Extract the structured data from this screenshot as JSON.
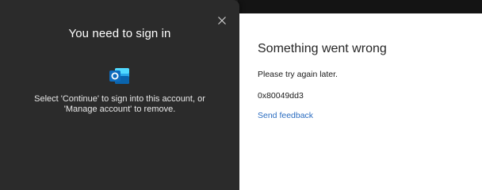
{
  "signin_dialog": {
    "title": "You need to sign in",
    "message_line1": "Select 'Continue' to sign into this account, or",
    "message_line2": "'Manage account' to remove.",
    "app_icon": "outlook-icon",
    "close_icon": "close-icon"
  },
  "error_panel": {
    "title": "Something went wrong",
    "message": "Please try again later.",
    "error_code": "0x80049dd3",
    "feedback_link": "Send feedback"
  },
  "colors": {
    "dialog_bg": "#2b2b2b",
    "error_bg": "#ffffff",
    "link": "#2a6cc0",
    "outlook_blue": "#0f6cbd"
  }
}
